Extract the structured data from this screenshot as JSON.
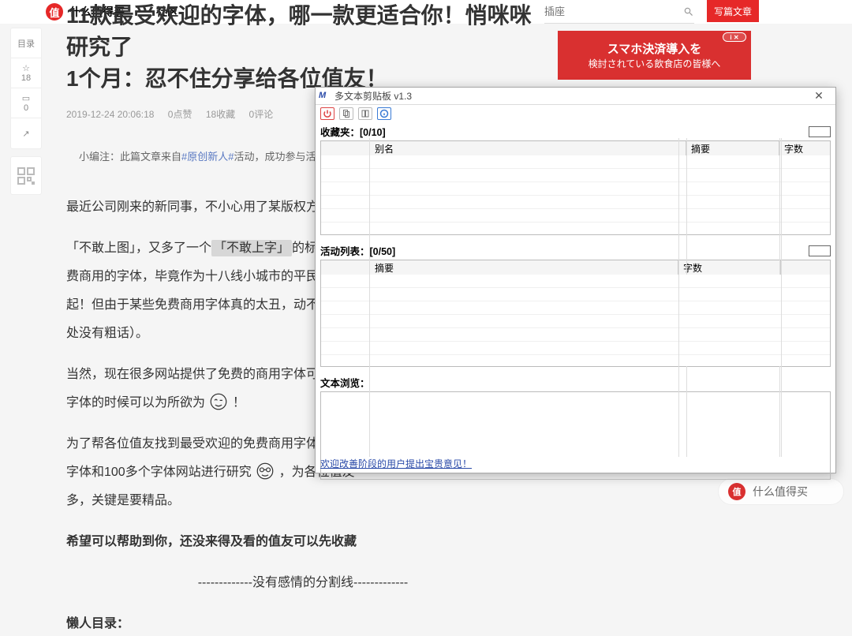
{
  "header": {
    "brand": "什么值得买",
    "nav2": "社区",
    "search_placeholder": "插座",
    "write_btn": "写篇文章"
  },
  "rail": {
    "toc": "目录",
    "like_count": "18",
    "comment_count": "0"
  },
  "article": {
    "title_line1": "11款最受欢迎的字体，哪一款更适合你！悄咪咪研究了",
    "title_line2": "1个月：忍不住分享给各位值友！",
    "meta": {
      "time": "2019-12-24 20:06:18",
      "likes": "0点赞",
      "favs": "18收藏",
      "comments": "0评论"
    },
    "note_prefix": "小编注：此篇文章来自",
    "note_tag": "#原创新人#",
    "note_suffix": "活动，成功参与活动将",
    "p1a": "最近公司刚来的新同事，不小心用了某版权方的字体",
    "p2a": "「不敢上图」，又多了一个",
    "p2hl": "「不敢上字」",
    "p2b": "的标签",
    "p3": "费商用的字体，毕竟作为十八线小城市的平民，生活",
    "p4": "起！但由于某些免费商用字体真的太丑，动不动还要",
    "p5": "处没有粗话）。",
    "p6": "当然，现在很多网站提供了免费的商用字体可供下载",
    "p7a": "字体的时候可以为所欲为",
    "p7b": "！",
    "p8": "为了帮各位值友找到最受欢迎的免费商用字体和相关",
    "p9a": "字体和100多个字体网站进行研究",
    "p9b": "，为各位值友",
    "p10": "多，关键是要精品。",
    "bold": "希望可以帮助到你，还没来得及看的值友可以先收藏",
    "divider": "-------------没有感情的分割线-------------",
    "lazytoc": "懒人目录："
  },
  "ad": {
    "l1": "スマホ決済導入を",
    "l2": "検討されている飲食店の皆様へ",
    "chip": "i ✕"
  },
  "watermark": "什么值得买",
  "win": {
    "title": "多文本剪贴板 v1.3",
    "close": "✕",
    "fav_label": "收藏夹：[0/10]",
    "act_label": "活动列表：[0/50]",
    "preview_label": "文本浏览：",
    "status": "欢迎改善阶段的用户提出宝贵意见！",
    "cols_fav": {
      "rowhead": "",
      "alias": "别名",
      "summary": "摘要",
      "chars": "字数"
    },
    "cols_act": {
      "rowhead": "",
      "summary": "摘要",
      "chars": "字数",
      "tail": ""
    }
  }
}
